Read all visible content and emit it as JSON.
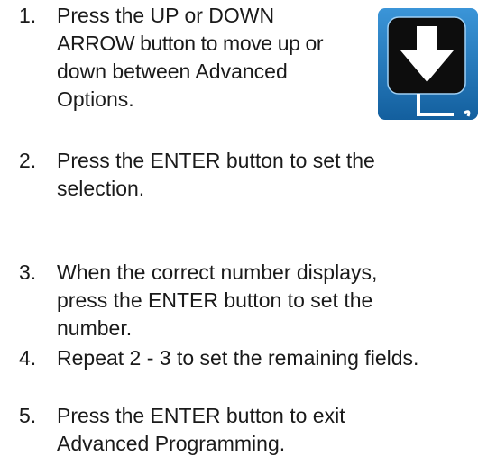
{
  "steps": [
    {
      "number": "1.",
      "lines": [
        "Press the UP or DOWN",
        "ARROW button to move up or",
        "down between Advanced",
        "Options."
      ]
    },
    {
      "number": "2.",
      "lines": [
        "Press the ENTER button to set the",
        "selection."
      ]
    },
    {
      "number": "3.",
      "lines": [
        "When the correct number displays,",
        "press the ENTER button to set the",
        "number."
      ]
    },
    {
      "number": "4.",
      "lines": [
        "Repeat 2 - 3 to set the remaining fields."
      ]
    },
    {
      "number": "5.",
      "lines": [
        "Press the ENTER button to exit",
        "Advanced Programming."
      ]
    }
  ],
  "icon": {
    "name": "down-arrow-enter-icon",
    "bg_color": "#1e7ac2",
    "panel_color": "#0d0d0d",
    "arrow_color": "#ffffff"
  }
}
